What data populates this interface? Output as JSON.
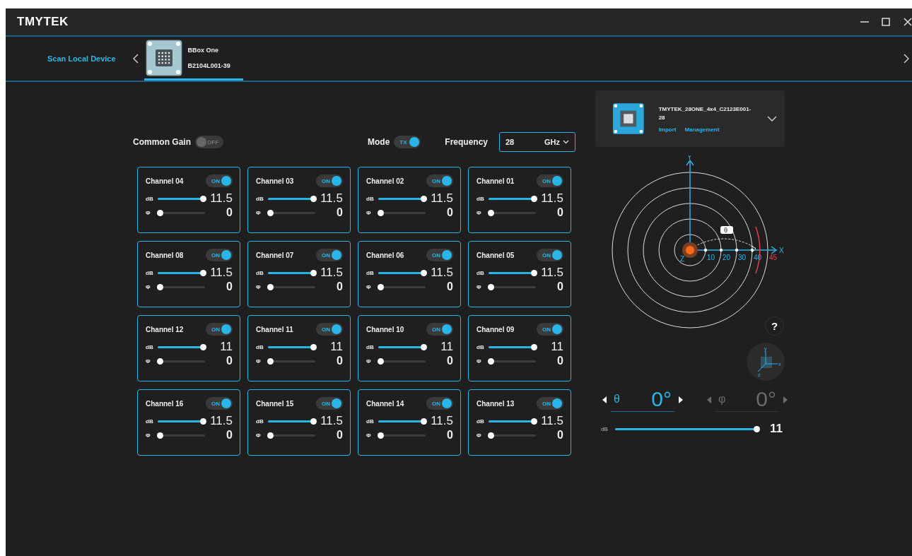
{
  "window": {
    "title": "TMYTEK"
  },
  "device_bar": {
    "scan_link": "Scan Local Device",
    "device": {
      "name": "BBox One",
      "serial": "B2104L001-39",
      "selected": true
    }
  },
  "controls": {
    "common_gain": {
      "label": "Common Gain",
      "value": "OFF",
      "on": false
    },
    "mode": {
      "label": "Mode",
      "value": "TX",
      "on": true
    },
    "frequency": {
      "label": "Frequency",
      "value": "28",
      "unit": "GHz"
    }
  },
  "channels": [
    {
      "name": "Channel 04",
      "on": true,
      "toggle": "ON",
      "gain": {
        "label": "dB",
        "level": 0.95,
        "reading": "11.5"
      },
      "phase": {
        "label": "Φ",
        "level": 0.05,
        "reading": "0"
      }
    },
    {
      "name": "Channel 03",
      "on": true,
      "toggle": "ON",
      "gain": {
        "label": "dB",
        "level": 0.95,
        "reading": "11.5"
      },
      "phase": {
        "label": "Φ",
        "level": 0.05,
        "reading": "0"
      }
    },
    {
      "name": "Channel 02",
      "on": true,
      "toggle": "ON",
      "gain": {
        "label": "dB",
        "level": 0.95,
        "reading": "11.5"
      },
      "phase": {
        "label": "Φ",
        "level": 0.05,
        "reading": "0"
      }
    },
    {
      "name": "Channel 01",
      "on": true,
      "toggle": "ON",
      "gain": {
        "label": "dB",
        "level": 0.95,
        "reading": "11.5"
      },
      "phase": {
        "label": "Φ",
        "level": 0.05,
        "reading": "0"
      }
    },
    {
      "name": "Channel 08",
      "on": true,
      "toggle": "ON",
      "gain": {
        "label": "dB",
        "level": 0.95,
        "reading": "11.5"
      },
      "phase": {
        "label": "Φ",
        "level": 0.05,
        "reading": "0"
      }
    },
    {
      "name": "Channel 07",
      "on": true,
      "toggle": "ON",
      "gain": {
        "label": "dB",
        "level": 0.95,
        "reading": "11.5"
      },
      "phase": {
        "label": "Φ",
        "level": 0.05,
        "reading": "0"
      }
    },
    {
      "name": "Channel 06",
      "on": true,
      "toggle": "ON",
      "gain": {
        "label": "dB",
        "level": 0.95,
        "reading": "11.5"
      },
      "phase": {
        "label": "Φ",
        "level": 0.05,
        "reading": "0"
      }
    },
    {
      "name": "Channel 05",
      "on": true,
      "toggle": "ON",
      "gain": {
        "label": "dB",
        "level": 0.95,
        "reading": "11.5"
      },
      "phase": {
        "label": "Φ",
        "level": 0.05,
        "reading": "0"
      }
    },
    {
      "name": "Channel 12",
      "on": true,
      "toggle": "ON",
      "gain": {
        "label": "dB",
        "level": 0.95,
        "reading": "11"
      },
      "phase": {
        "label": "Φ",
        "level": 0.05,
        "reading": "0"
      }
    },
    {
      "name": "Channel 11",
      "on": true,
      "toggle": "ON",
      "gain": {
        "label": "dB",
        "level": 0.95,
        "reading": "11"
      },
      "phase": {
        "label": "Φ",
        "level": 0.05,
        "reading": "0"
      }
    },
    {
      "name": "Channel 10",
      "on": true,
      "toggle": "ON",
      "gain": {
        "label": "dB",
        "level": 0.95,
        "reading": "11"
      },
      "phase": {
        "label": "Φ",
        "level": 0.05,
        "reading": "0"
      }
    },
    {
      "name": "Channel 09",
      "on": true,
      "toggle": "ON",
      "gain": {
        "label": "dB",
        "level": 0.95,
        "reading": "11"
      },
      "phase": {
        "label": "Φ",
        "level": 0.05,
        "reading": "0"
      }
    },
    {
      "name": "Channel 16",
      "on": true,
      "toggle": "ON",
      "gain": {
        "label": "dB",
        "level": 0.95,
        "reading": "11.5"
      },
      "phase": {
        "label": "Φ",
        "level": 0.05,
        "reading": "0"
      }
    },
    {
      "name": "Channel 15",
      "on": true,
      "toggle": "ON",
      "gain": {
        "label": "dB",
        "level": 0.95,
        "reading": "11.5"
      },
      "phase": {
        "label": "Φ",
        "level": 0.05,
        "reading": "0"
      }
    },
    {
      "name": "Channel 14",
      "on": true,
      "toggle": "ON",
      "gain": {
        "label": "dB",
        "level": 0.95,
        "reading": "11.5"
      },
      "phase": {
        "label": "Φ",
        "level": 0.05,
        "reading": "0"
      }
    },
    {
      "name": "Channel 13",
      "on": true,
      "toggle": "ON",
      "gain": {
        "label": "dB",
        "level": 0.95,
        "reading": "11.5"
      },
      "phase": {
        "label": "Φ",
        "level": 0.05,
        "reading": "0"
      }
    }
  ],
  "device_card": {
    "name": "TMYTEK_28ONE_4x4_C2123E001-28",
    "links": [
      "Import",
      "Management"
    ]
  },
  "polar": {
    "x": "X",
    "y": "Y",
    "z": "Z",
    "theta_tag": "θ",
    "ticks": [
      "10",
      "20",
      "30",
      "40"
    ],
    "limit": "45"
  },
  "help": "?",
  "orientation": {
    "x": "x",
    "y": "y",
    "z": "z"
  },
  "steering": [
    {
      "symbol": "θ",
      "value": "0°",
      "disabled": false
    },
    {
      "symbol": "φ",
      "value": "0°",
      "disabled": true
    }
  ],
  "beam_gain": {
    "label": "dB",
    "level": 1,
    "reading": "11"
  }
}
